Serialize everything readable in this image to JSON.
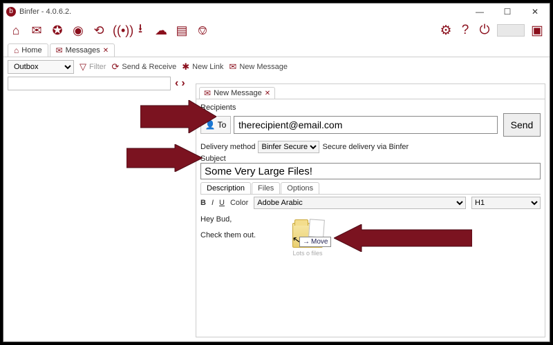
{
  "title": "Binfer - 4.0.6.2.",
  "tabs": {
    "home": "Home",
    "messages": "Messages"
  },
  "subbar": {
    "mailbox": "Outbox",
    "filter": "Filter",
    "sendrecv": "Send & Receive",
    "newlink": "New Link",
    "newmsg": "New Message"
  },
  "nav": {
    "prev": "‹",
    "next": "›"
  },
  "composer": {
    "tab": "New Message",
    "recipients_lbl": "Recipients",
    "to_lbl": "To",
    "to_value": "therecipient@email.com",
    "send": "Send",
    "dmethod_lbl": "Delivery method",
    "dmethod_value": "Binfer Secure",
    "dmethod_note": "Secure delivery via Binfer",
    "subject_lbl": "Subject",
    "subject_value": "Some Very Large Files!",
    "inner": {
      "desc": "Description",
      "files": "Files",
      "options": "Options"
    },
    "fmt": {
      "b": "B",
      "i": "I",
      "u": "U",
      "color": "Color",
      "font": "Adobe Arabic",
      "heading": "H1"
    },
    "body1": "Hey Bud,",
    "body2": "Check them out."
  },
  "folder": {
    "caption": "Lots o files",
    "tooltip": "Move"
  }
}
